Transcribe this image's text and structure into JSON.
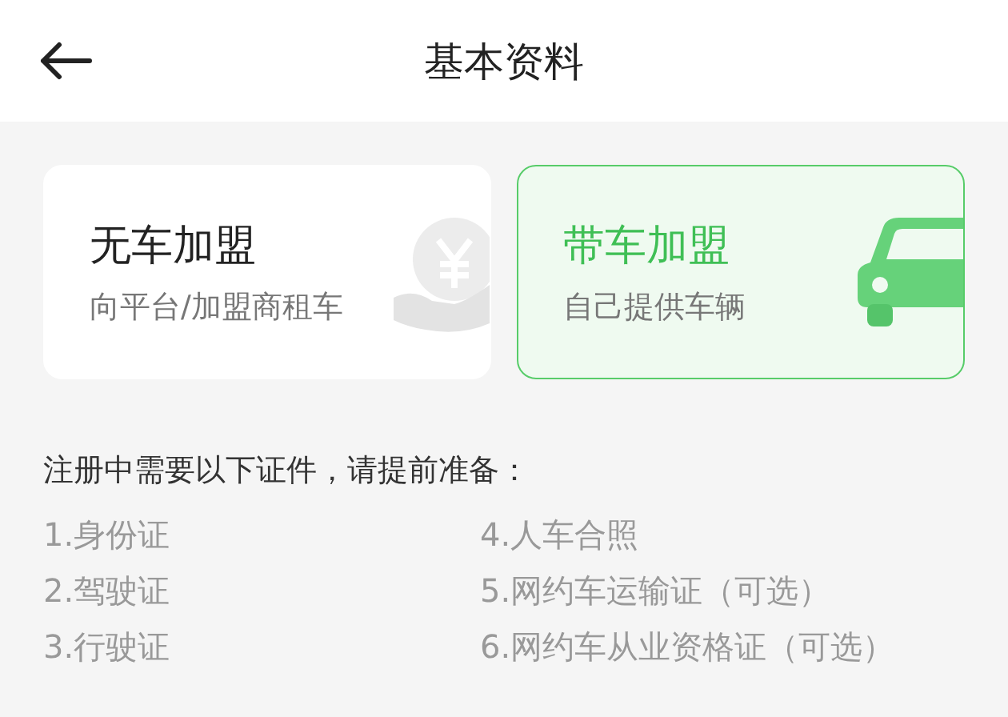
{
  "header": {
    "title": "基本资料"
  },
  "join_options": [
    {
      "kind": "no-car",
      "title": "无车加盟",
      "subtitle": "向平台/加盟商租车",
      "selected": false
    },
    {
      "kind": "with-car",
      "title": "带车加盟",
      "subtitle": "自己提供车辆",
      "selected": true
    }
  ],
  "requirements": {
    "heading": "注册中需要以下证件，请提前准备：",
    "documents": [
      "1.身份证",
      "2.驾驶证",
      "3.行驶证",
      "4.人车合照",
      "5.网约车运输证（可选）",
      "6.网约车从业资格证（可选）"
    ]
  }
}
